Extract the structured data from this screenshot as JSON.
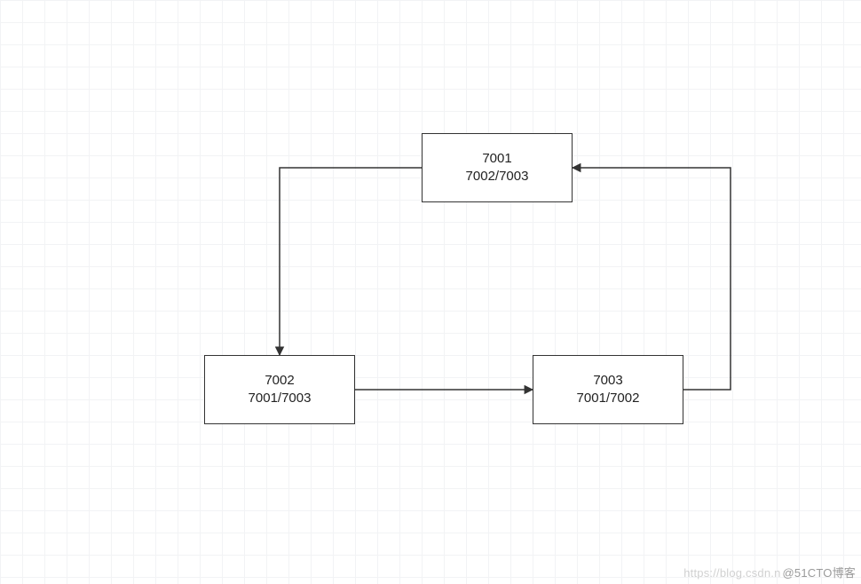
{
  "diagram": {
    "nodes": {
      "a": {
        "line1": "7001",
        "line2": "7002/7003"
      },
      "b": {
        "line1": "7002",
        "line2": "7001/7003"
      },
      "c": {
        "line1": "7003",
        "line2": "7001/7002"
      }
    },
    "edges": [
      {
        "from": "a",
        "to": "b"
      },
      {
        "from": "b",
        "to": "c"
      },
      {
        "from": "c",
        "to": "a"
      }
    ]
  },
  "watermark": {
    "faint": "https://blog.csdn.n",
    "main": "@51CTO博客"
  }
}
